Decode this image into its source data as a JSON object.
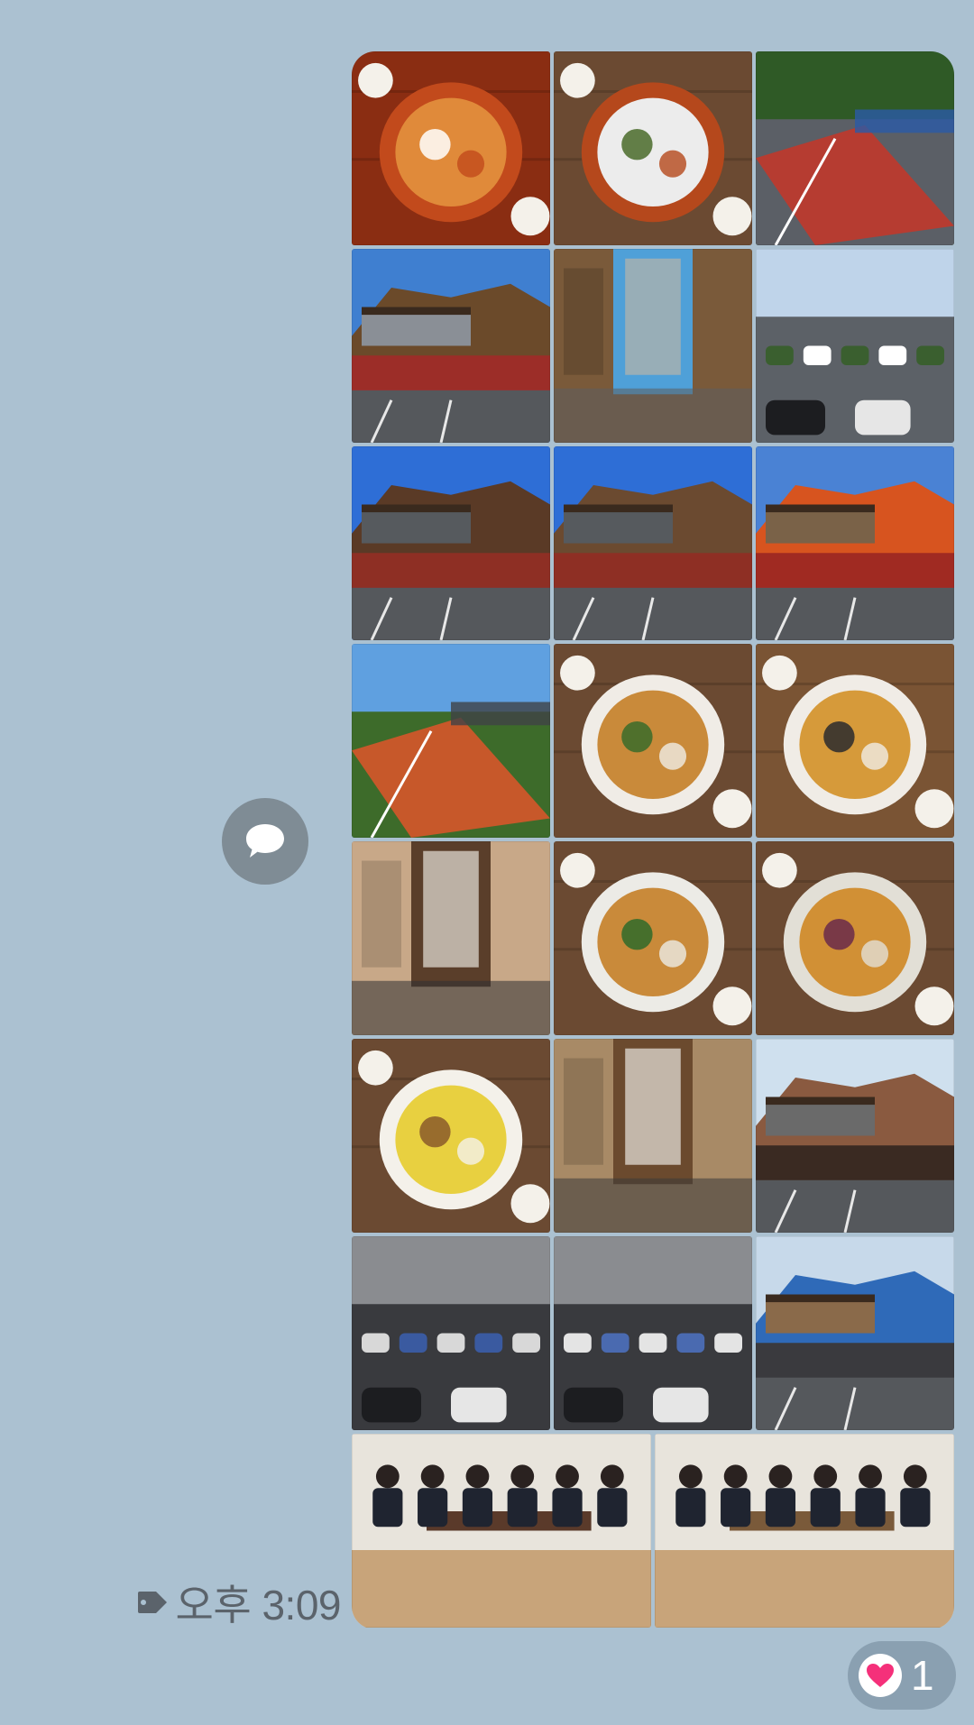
{
  "message": {
    "time": "오후 3:09",
    "reaction": {
      "emoji_icon": "heart-icon",
      "count": "1",
      "color": "#f5307a"
    },
    "share_icon": "speech-bubble-icon",
    "time_icon": "tag-icon"
  },
  "photos": [
    {
      "name": "photo-stew-bowl",
      "scene": "food",
      "colors": [
        "#8a2d12",
        "#c24a1c",
        "#e08a3a",
        "#ffffff"
      ]
    },
    {
      "name": "photo-stew-table",
      "scene": "food",
      "colors": [
        "#6b4a32",
        "#b5481c",
        "#ececec",
        "#4a6b2a"
      ]
    },
    {
      "name": "photo-road-fence",
      "scene": "road",
      "colors": [
        "#2f5a26",
        "#5b5f66",
        "#c0392b",
        "#2a5aa8"
      ]
    },
    {
      "name": "photo-building-steps",
      "scene": "outdoor",
      "colors": [
        "#3f7fd0",
        "#9c2d28",
        "#6b4a2a",
        "#8a8f96"
      ]
    },
    {
      "name": "photo-glass-door",
      "scene": "door",
      "colors": [
        "#7a5a3a",
        "#4fa0d8",
        "#b8b4aa",
        "#5d5f60"
      ]
    },
    {
      "name": "photo-parking-sign",
      "scene": "parking",
      "colors": [
        "#bfd4ea",
        "#4a4c50",
        "#ffffff",
        "#3a5f2f"
      ]
    },
    {
      "name": "photo-restaurant-front",
      "scene": "building",
      "colors": [
        "#2e6ed6",
        "#8e2f24",
        "#5a3a26",
        "#565a5e"
      ]
    },
    {
      "name": "photo-restaurant-side",
      "scene": "building",
      "colors": [
        "#2e6ed6",
        "#8e2f24",
        "#6b4a30",
        "#565a5e"
      ]
    },
    {
      "name": "photo-stairs-railing",
      "scene": "outdoor",
      "colors": [
        "#4a82d4",
        "#a02a22",
        "#d7541f",
        "#7a6248"
      ]
    },
    {
      "name": "photo-red-path",
      "scene": "road",
      "colors": [
        "#5fa0e0",
        "#3d6b2a",
        "#d6562a",
        "#404246"
      ]
    },
    {
      "name": "photo-pancakes-chopsticks",
      "scene": "food",
      "colors": [
        "#6b4a32",
        "#f0ece6",
        "#c98a3a",
        "#3a6b2a"
      ]
    },
    {
      "name": "photo-table-setting",
      "scene": "food",
      "colors": [
        "#7a5434",
        "#f0ece6",
        "#d69a3a",
        "#2a2a2e"
      ]
    },
    {
      "name": "photo-dining-hall",
      "scene": "interior",
      "colors": [
        "#c8a888",
        "#5a3e2a",
        "#e6e2da",
        "#2f2f33"
      ]
    },
    {
      "name": "photo-pancake-plate",
      "scene": "food",
      "colors": [
        "#6b4a32",
        "#ecebe6",
        "#c98a3a",
        "#2f6a2a"
      ]
    },
    {
      "name": "photo-pancake-closeup",
      "scene": "food",
      "colors": [
        "#6b4a32",
        "#e2dfd6",
        "#d19035",
        "#6a2a4a"
      ]
    },
    {
      "name": "photo-side-dishes",
      "scene": "food",
      "colors": [
        "#6b4a32",
        "#f4f1ea",
        "#e8d040",
        "#8a5a2a"
      ]
    },
    {
      "name": "photo-interior-door",
      "scene": "interior",
      "colors": [
        "#a88a66",
        "#6b4a2e",
        "#e8e6df",
        "#3a3a3a"
      ]
    },
    {
      "name": "photo-deck-view",
      "scene": "outdoor",
      "colors": [
        "#cfe0ee",
        "#3a2a22",
        "#8a5a40",
        "#6a6a6a"
      ]
    },
    {
      "name": "photo-parking-lot-1",
      "scene": "parking",
      "colors": [
        "#8a8c90",
        "#2a2c30",
        "#3a5aa0",
        "#d8d8d8"
      ]
    },
    {
      "name": "photo-parking-lot-2",
      "scene": "parking",
      "colors": [
        "#8a8c90",
        "#2a2c30",
        "#4a6ab0",
        "#e4e4e4"
      ]
    },
    {
      "name": "photo-city-view",
      "scene": "outdoor",
      "colors": [
        "#c7d9ea",
        "#3a3a3e",
        "#2f6ab8",
        "#8a6a4a"
      ]
    },
    {
      "name": "photo-diners-1",
      "scene": "people",
      "colors": [
        "#c8a47a",
        "#1f2430",
        "#e8e4dc",
        "#5a3a2a"
      ]
    },
    {
      "name": "photo-diners-2",
      "scene": "people",
      "colors": [
        "#c8a47a",
        "#1f2430",
        "#e8e4dc",
        "#7a5a3a"
      ]
    }
  ]
}
